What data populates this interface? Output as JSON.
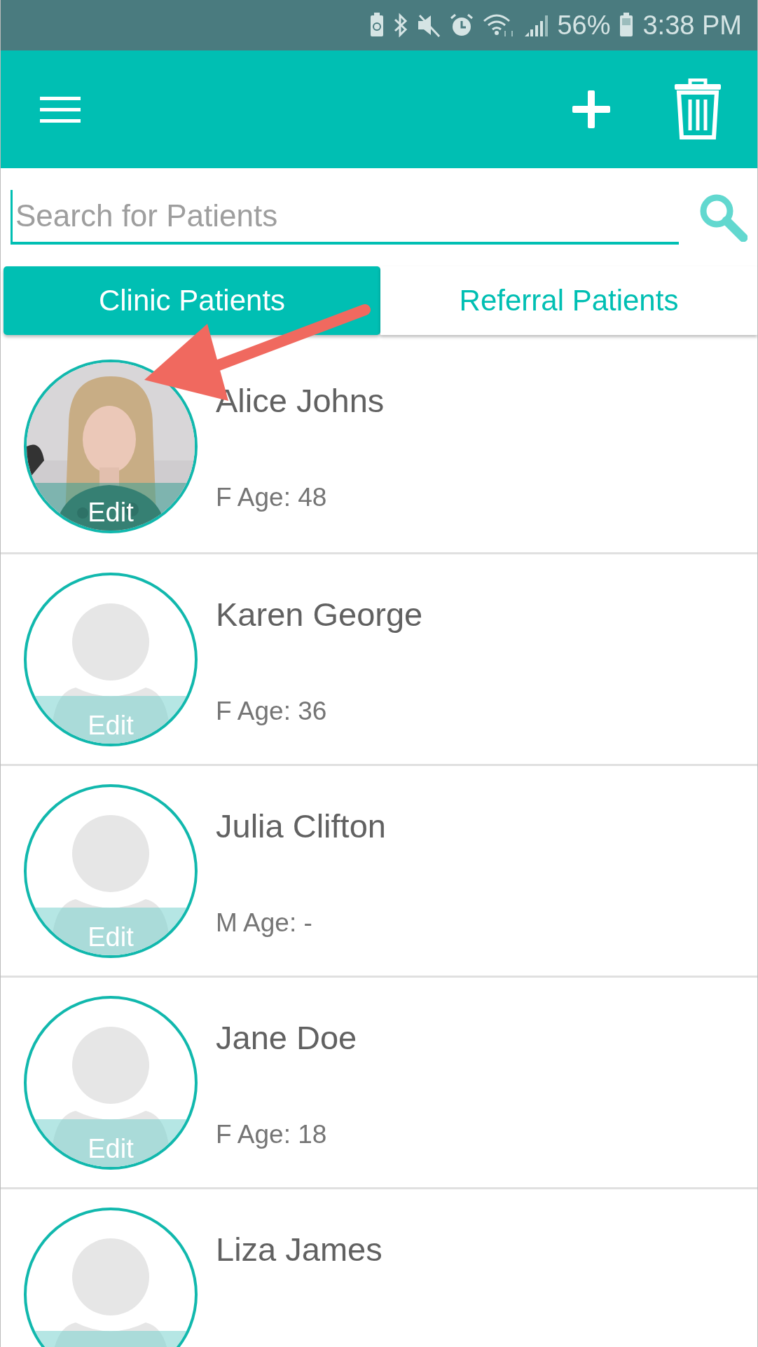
{
  "status_bar": {
    "battery": "56%",
    "time": "3:38 PM"
  },
  "search": {
    "placeholder": "Search for Patients"
  },
  "tabs": [
    {
      "label": "Clinic Patients",
      "selected": true
    },
    {
      "label": "Referral Patients",
      "selected": false
    }
  ],
  "patients": [
    {
      "name": "Alice Johns",
      "details": "F Age: 48",
      "edit": "Edit"
    },
    {
      "name": "Karen George",
      "details": "F Age: 36",
      "edit": "Edit"
    },
    {
      "name": "Julia Clifton",
      "details": "M Age: -",
      "edit": "Edit"
    },
    {
      "name": "Jane Doe",
      "details": "F Age: 18",
      "edit": "Edit"
    },
    {
      "name": "Liza James"
    }
  ]
}
